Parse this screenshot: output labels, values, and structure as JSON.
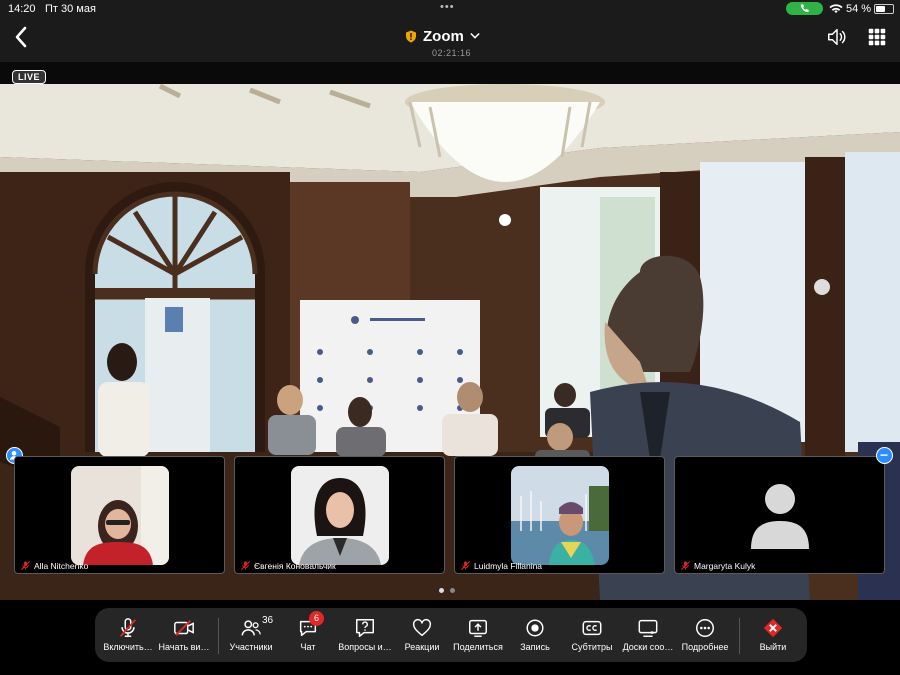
{
  "status_bar": {
    "time": "14:20",
    "date": "Пт 30 мая",
    "battery_percent": "54 %",
    "battery_level": 0.54,
    "call_indicator_color": "#2fb347"
  },
  "header": {
    "app_title": "Zoom",
    "timer": "02:21:16",
    "shield_color": "#f0a500",
    "icons": [
      "back-chevron",
      "shield",
      "chevron-down",
      "speaker",
      "grid"
    ]
  },
  "video": {
    "live_label": "LIVE"
  },
  "participants": [
    {
      "name": "Alla Nitchenko",
      "muted": true,
      "avatar": "photo"
    },
    {
      "name": "Євгенія Коновальчик",
      "muted": true,
      "avatar": "photo"
    },
    {
      "name": "Luidmyla Fillanina",
      "muted": true,
      "avatar": "photo"
    },
    {
      "name": "Margaryta Kulyk",
      "muted": true,
      "avatar": "placeholder"
    }
  ],
  "pager": {
    "pages": 2,
    "current": 1
  },
  "toolbar": {
    "mic": "Включить…",
    "video": "Начать ви…",
    "participants": "Участники",
    "participants_count": "36",
    "chat": "Чат",
    "chat_badge": "6",
    "qa": "Вопросы и…",
    "reactions": "Реакции",
    "share": "Поделиться",
    "record": "Запись",
    "subtitles": "Субтитры",
    "whiteboard": "Доски соо…",
    "more": "Подробнее",
    "leave": "Выйти"
  },
  "colors": {
    "accent": "#2d8cff",
    "danger": "#e02828",
    "toolbar_bg": "#262626"
  }
}
